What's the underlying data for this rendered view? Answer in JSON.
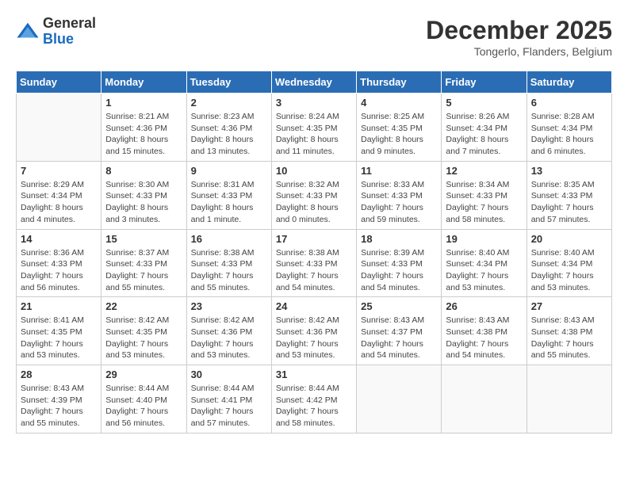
{
  "header": {
    "logo_line1": "General",
    "logo_line2": "Blue",
    "month_year": "December 2025",
    "location": "Tongerlo, Flanders, Belgium"
  },
  "days_of_week": [
    "Sunday",
    "Monday",
    "Tuesday",
    "Wednesday",
    "Thursday",
    "Friday",
    "Saturday"
  ],
  "weeks": [
    [
      {
        "day": "",
        "info": ""
      },
      {
        "day": "1",
        "info": "Sunrise: 8:21 AM\nSunset: 4:36 PM\nDaylight: 8 hours\nand 15 minutes."
      },
      {
        "day": "2",
        "info": "Sunrise: 8:23 AM\nSunset: 4:36 PM\nDaylight: 8 hours\nand 13 minutes."
      },
      {
        "day": "3",
        "info": "Sunrise: 8:24 AM\nSunset: 4:35 PM\nDaylight: 8 hours\nand 11 minutes."
      },
      {
        "day": "4",
        "info": "Sunrise: 8:25 AM\nSunset: 4:35 PM\nDaylight: 8 hours\nand 9 minutes."
      },
      {
        "day": "5",
        "info": "Sunrise: 8:26 AM\nSunset: 4:34 PM\nDaylight: 8 hours\nand 7 minutes."
      },
      {
        "day": "6",
        "info": "Sunrise: 8:28 AM\nSunset: 4:34 PM\nDaylight: 8 hours\nand 6 minutes."
      }
    ],
    [
      {
        "day": "7",
        "info": "Sunrise: 8:29 AM\nSunset: 4:34 PM\nDaylight: 8 hours\nand 4 minutes."
      },
      {
        "day": "8",
        "info": "Sunrise: 8:30 AM\nSunset: 4:33 PM\nDaylight: 8 hours\nand 3 minutes."
      },
      {
        "day": "9",
        "info": "Sunrise: 8:31 AM\nSunset: 4:33 PM\nDaylight: 8 hours\nand 1 minute."
      },
      {
        "day": "10",
        "info": "Sunrise: 8:32 AM\nSunset: 4:33 PM\nDaylight: 8 hours\nand 0 minutes."
      },
      {
        "day": "11",
        "info": "Sunrise: 8:33 AM\nSunset: 4:33 PM\nDaylight: 7 hours\nand 59 minutes."
      },
      {
        "day": "12",
        "info": "Sunrise: 8:34 AM\nSunset: 4:33 PM\nDaylight: 7 hours\nand 58 minutes."
      },
      {
        "day": "13",
        "info": "Sunrise: 8:35 AM\nSunset: 4:33 PM\nDaylight: 7 hours\nand 57 minutes."
      }
    ],
    [
      {
        "day": "14",
        "info": "Sunrise: 8:36 AM\nSunset: 4:33 PM\nDaylight: 7 hours\nand 56 minutes."
      },
      {
        "day": "15",
        "info": "Sunrise: 8:37 AM\nSunset: 4:33 PM\nDaylight: 7 hours\nand 55 minutes."
      },
      {
        "day": "16",
        "info": "Sunrise: 8:38 AM\nSunset: 4:33 PM\nDaylight: 7 hours\nand 55 minutes."
      },
      {
        "day": "17",
        "info": "Sunrise: 8:38 AM\nSunset: 4:33 PM\nDaylight: 7 hours\nand 54 minutes."
      },
      {
        "day": "18",
        "info": "Sunrise: 8:39 AM\nSunset: 4:33 PM\nDaylight: 7 hours\nand 54 minutes."
      },
      {
        "day": "19",
        "info": "Sunrise: 8:40 AM\nSunset: 4:34 PM\nDaylight: 7 hours\nand 53 minutes."
      },
      {
        "day": "20",
        "info": "Sunrise: 8:40 AM\nSunset: 4:34 PM\nDaylight: 7 hours\nand 53 minutes."
      }
    ],
    [
      {
        "day": "21",
        "info": "Sunrise: 8:41 AM\nSunset: 4:35 PM\nDaylight: 7 hours\nand 53 minutes."
      },
      {
        "day": "22",
        "info": "Sunrise: 8:42 AM\nSunset: 4:35 PM\nDaylight: 7 hours\nand 53 minutes."
      },
      {
        "day": "23",
        "info": "Sunrise: 8:42 AM\nSunset: 4:36 PM\nDaylight: 7 hours\nand 53 minutes."
      },
      {
        "day": "24",
        "info": "Sunrise: 8:42 AM\nSunset: 4:36 PM\nDaylight: 7 hours\nand 53 minutes."
      },
      {
        "day": "25",
        "info": "Sunrise: 8:43 AM\nSunset: 4:37 PM\nDaylight: 7 hours\nand 54 minutes."
      },
      {
        "day": "26",
        "info": "Sunrise: 8:43 AM\nSunset: 4:38 PM\nDaylight: 7 hours\nand 54 minutes."
      },
      {
        "day": "27",
        "info": "Sunrise: 8:43 AM\nSunset: 4:38 PM\nDaylight: 7 hours\nand 55 minutes."
      }
    ],
    [
      {
        "day": "28",
        "info": "Sunrise: 8:43 AM\nSunset: 4:39 PM\nDaylight: 7 hours\nand 55 minutes."
      },
      {
        "day": "29",
        "info": "Sunrise: 8:44 AM\nSunset: 4:40 PM\nDaylight: 7 hours\nand 56 minutes."
      },
      {
        "day": "30",
        "info": "Sunrise: 8:44 AM\nSunset: 4:41 PM\nDaylight: 7 hours\nand 57 minutes."
      },
      {
        "day": "31",
        "info": "Sunrise: 8:44 AM\nSunset: 4:42 PM\nDaylight: 7 hours\nand 58 minutes."
      },
      {
        "day": "",
        "info": ""
      },
      {
        "day": "",
        "info": ""
      },
      {
        "day": "",
        "info": ""
      }
    ]
  ]
}
